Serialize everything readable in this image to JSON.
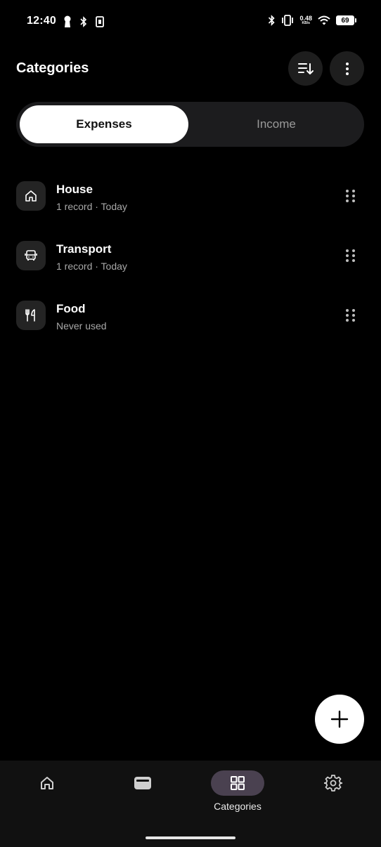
{
  "status_bar": {
    "time": "12:40",
    "net_speed_value": "0.48",
    "net_speed_unit": "KB/s",
    "battery_level": "69",
    "left_icons": [
      "keyhole-icon",
      "bluetooth-icon",
      "nfc-icon"
    ],
    "right_icons": [
      "bluetooth-icon",
      "vibrate-icon",
      "wifi-icon",
      "battery-icon"
    ]
  },
  "header": {
    "title": "Categories",
    "sort_icon": "sort-icon",
    "more_icon": "more-vertical-icon"
  },
  "tabs": {
    "expenses": "Expenses",
    "income": "Income",
    "selected": "Expenses"
  },
  "categories": [
    {
      "name": "House",
      "subtitle": "1 record · Today",
      "icon": "house-icon"
    },
    {
      "name": "Transport",
      "subtitle": "1 record · Today",
      "icon": "bus-icon"
    },
    {
      "name": "Food",
      "subtitle": "Never used",
      "icon": "fork-knife-icon"
    }
  ],
  "fab": {
    "icon": "plus-icon"
  },
  "bottom_nav": {
    "items": [
      {
        "id": "home",
        "icon": "home-icon",
        "label": ""
      },
      {
        "id": "wallet",
        "icon": "wallet-icon",
        "label": ""
      },
      {
        "id": "categories",
        "icon": "grid-icon",
        "label": "Categories",
        "active": true
      },
      {
        "id": "settings",
        "icon": "gear-icon",
        "label": ""
      }
    ]
  },
  "colors": {
    "background": "#000000",
    "surface": "#1c1c1e",
    "active_pill": "#4a4150",
    "secondary_text": "#a8a8a8"
  }
}
